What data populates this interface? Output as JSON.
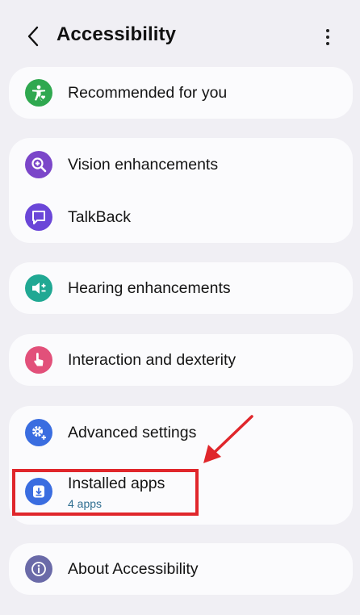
{
  "header": {
    "title": "Accessibility"
  },
  "items": {
    "recommended": {
      "label": "Recommended for you",
      "icon": "accessibility-person-icon",
      "color": "#2fa84f"
    },
    "vision": {
      "label": "Vision enhancements",
      "icon": "zoom-in-icon",
      "color": "#7b46c9"
    },
    "talkback": {
      "label": "TalkBack",
      "icon": "talkback-icon",
      "color": "#6a46d8"
    },
    "hearing": {
      "label": "Hearing enhancements",
      "icon": "volume-icon",
      "color": "#20a893"
    },
    "interaction": {
      "label": "Interaction and dexterity",
      "icon": "touch-hand-icon",
      "color": "#e2507a"
    },
    "advanced": {
      "label": "Advanced settings",
      "icon": "gear-plus-icon",
      "color": "#3a6de0"
    },
    "installed": {
      "label": "Installed apps",
      "sub": "4 apps",
      "icon": "download-app-icon",
      "color": "#3a6de0"
    },
    "about": {
      "label": "About Accessibility",
      "icon": "info-icon",
      "color": "#6a6aa8"
    }
  },
  "annotation": {
    "highlight_color": "#e0262b"
  }
}
